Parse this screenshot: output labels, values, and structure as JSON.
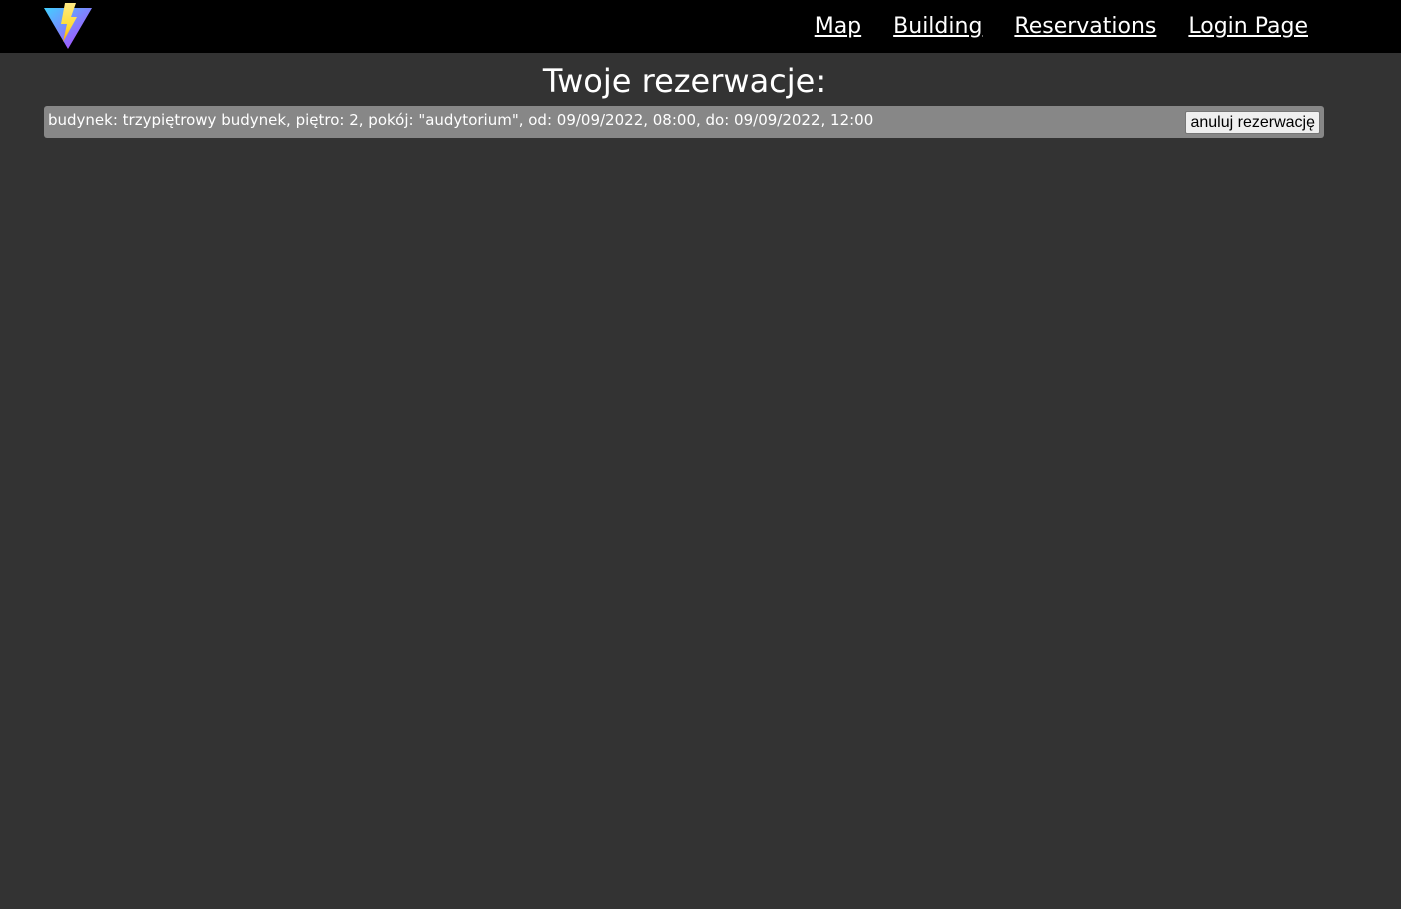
{
  "header": {
    "logo_icon": "lightning-triangle-logo",
    "nav": [
      {
        "label": "Map"
      },
      {
        "label": "Building"
      },
      {
        "label": "Reservations"
      },
      {
        "label": "Login Page"
      }
    ]
  },
  "main": {
    "title": "Twoje rezerwacje:",
    "reservations": [
      {
        "text": "budynek: trzypiętrowy budynek, piętro: 2, pokój: \"audytorium\", od: 09/09/2022, 08:00, do: 09/09/2022, 12:00",
        "cancel_label": "anuluj rezerwację"
      }
    ]
  },
  "colors": {
    "page_background": "#333333",
    "navbar_background": "#000000",
    "reservation_background": "#878787",
    "logo_blue": "#41d1ff",
    "logo_purple": "#bd34fe",
    "logo_yellow": "#ffdd35"
  }
}
